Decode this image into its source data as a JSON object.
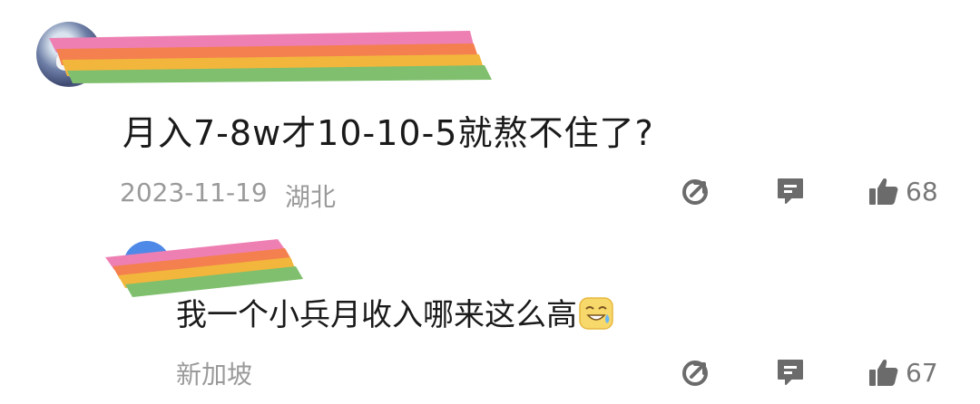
{
  "comment": {
    "text": "月入7-8w才10-10-5就熬不住了?",
    "date": "2023-11-19",
    "location": "湖北",
    "likes": "68"
  },
  "reply": {
    "text": "我一个小兵月收入哪来这么高",
    "location": "新加坡",
    "likes": "67"
  },
  "icons": {
    "share": "share-icon",
    "comment": "comment-icon",
    "like": "thumbs-up-icon",
    "emoji": "sweat-laugh-emoji-icon"
  },
  "colors": {
    "text": "#1a1a1a",
    "meta": "#9a9a9a",
    "icon": "#6b6b6b",
    "band": [
      "#ee7fb3",
      "#f47f4f",
      "#f2b63c",
      "#7fbf6d"
    ]
  }
}
